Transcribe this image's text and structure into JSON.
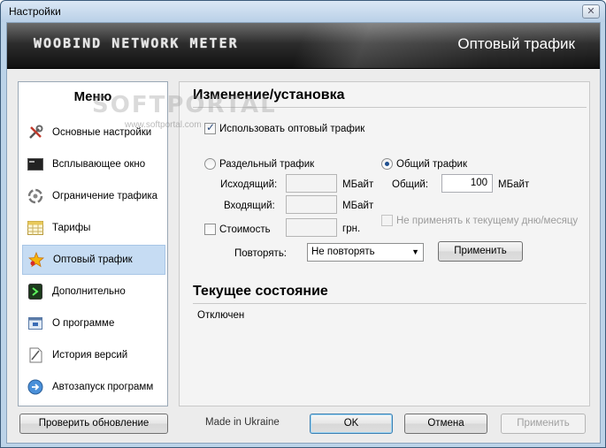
{
  "window": {
    "title": "Настройки",
    "close_glyph": "✕"
  },
  "banner": {
    "logo_text": "WOOBIND NETWORK METER",
    "section_title": "Оптовый трафик"
  },
  "sidebar": {
    "header": "Меню",
    "items": [
      {
        "label": "Основные настройки",
        "icon": "tools-icon",
        "selected": false
      },
      {
        "label": "Всплывающее окно",
        "icon": "popup-window-icon",
        "selected": false
      },
      {
        "label": "Ограничение трафика",
        "icon": "traffic-limit-icon",
        "selected": false
      },
      {
        "label": "Тарифы",
        "icon": "tariff-table-icon",
        "selected": false
      },
      {
        "label": "Оптовый трафик",
        "icon": "star-icon",
        "selected": true
      },
      {
        "label": "Дополнительно",
        "icon": "extra-icon",
        "selected": false
      },
      {
        "label": "О программе",
        "icon": "about-icon",
        "selected": false
      },
      {
        "label": "История версий",
        "icon": "history-icon",
        "selected": false
      },
      {
        "label": "Автозапуск программ",
        "icon": "autorun-icon",
        "selected": false
      }
    ]
  },
  "settings": {
    "section_title": "Изменение/установка",
    "use_wholesale_label": "Использовать оптовый трафик",
    "use_wholesale_checked": true,
    "separate_traffic_label": "Раздельный трафик",
    "total_traffic_label": "Общий трафик",
    "selected_mode": "total",
    "outgoing_label": "Исходящий:",
    "outgoing_value": "",
    "incoming_label": "Входящий:",
    "incoming_value": "",
    "unit_mb": "МБайт",
    "total_label": "Общий:",
    "total_value": "100",
    "cost_label": "Стоимость",
    "cost_checked": false,
    "cost_value": "",
    "currency": "грн.",
    "not_apply_label": "Не применять к текущему дню/месяцу",
    "repeat_label": "Повторять:",
    "repeat_value": "Не повторять",
    "apply_button": "Применить"
  },
  "status": {
    "section_title": "Текущее состояние",
    "value": "Отключен"
  },
  "footer": {
    "check_update_button": "Проверить обновление",
    "made_in": "Made in Ukraine",
    "ok_button": "OK",
    "cancel_button": "Отмена",
    "apply_button": "Применить"
  },
  "watermark": {
    "big": "SOFTPORTAL",
    "small": "www.softportal.com"
  },
  "colors": {
    "selected_item_bg": "#c6dcf3",
    "banner_dark": "#111111",
    "window_frame": "#bcd3e8"
  }
}
